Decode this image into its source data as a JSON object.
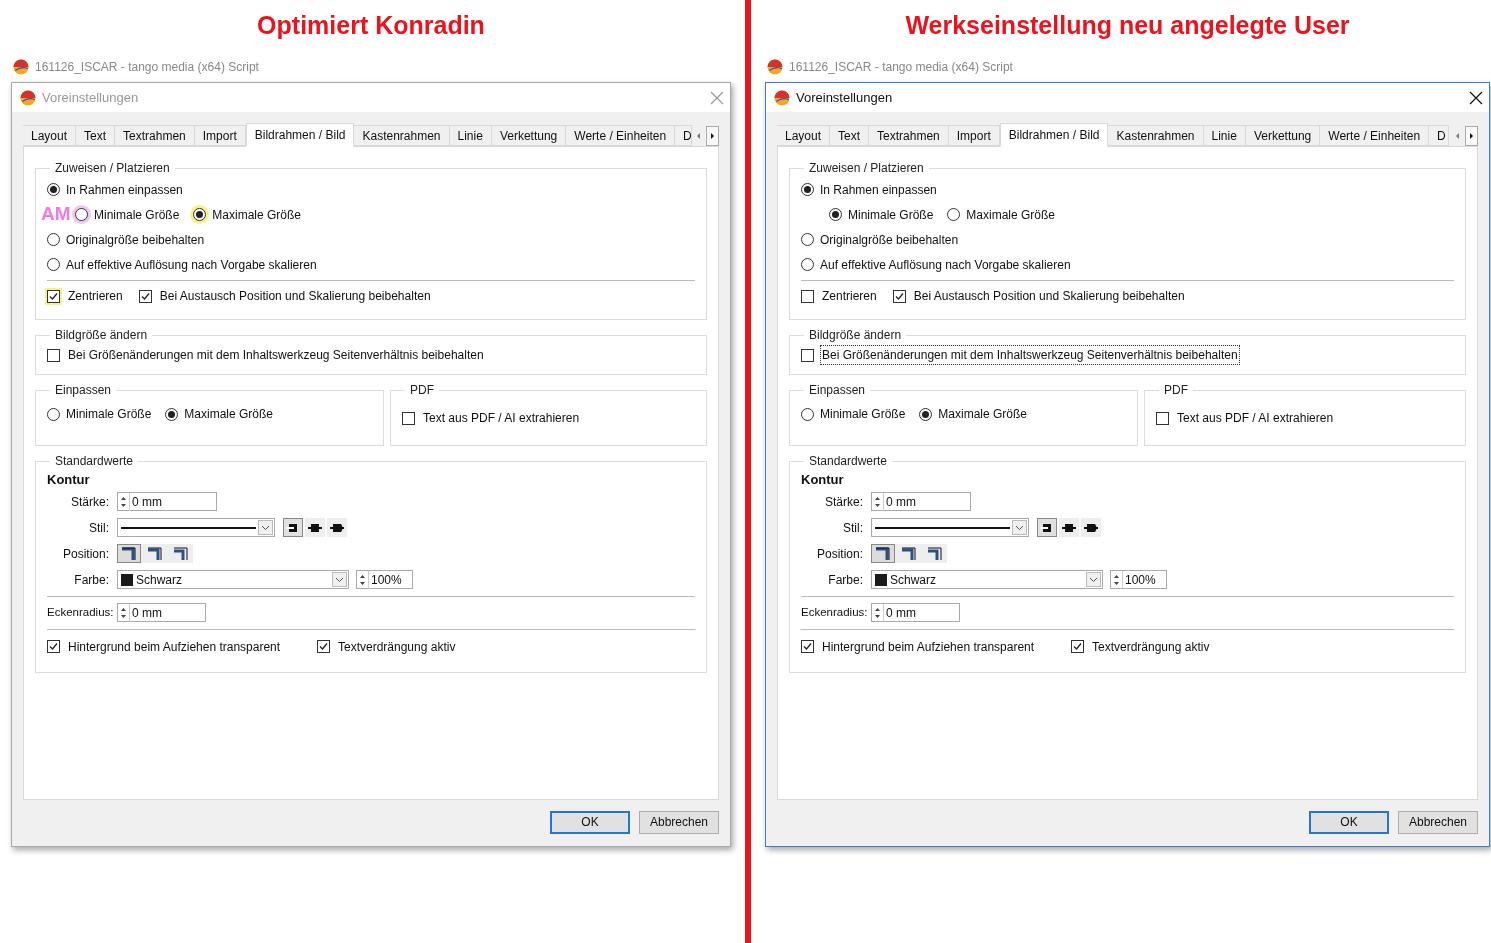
{
  "panels": [
    {
      "heading": "Optimiert Konradin",
      "app_title": "161126_ISCAR - tango media (x64) Script",
      "dialog": {
        "title": "Voreinstellungen",
        "active": false,
        "tabs": [
          {
            "label": "Layout",
            "selected": false
          },
          {
            "label": "Text",
            "selected": false
          },
          {
            "label": "Textrahmen",
            "selected": false
          },
          {
            "label": "Import",
            "selected": false
          },
          {
            "label": "Bildrahmen / Bild",
            "selected": true
          },
          {
            "label": "Kastenrahmen",
            "selected": false
          },
          {
            "label": "Linie",
            "selected": false
          },
          {
            "label": "Verkettung",
            "selected": false
          },
          {
            "label": "Werte / Einheiten",
            "selected": false
          },
          {
            "label": "D",
            "selected": false
          }
        ],
        "zuweisen": {
          "title": "Zuweisen / Platzieren",
          "annotation": {
            "text": "AM",
            "color": "#f07ae0"
          },
          "options": [
            {
              "label": "In Rahmen einpassen",
              "selected": true
            },
            {
              "label": "Originalgröße beibehalten",
              "selected": false
            },
            {
              "label": "Auf effektive Auflösung nach Vorgabe skalieren",
              "selected": false
            }
          ],
          "sub_options": [
            {
              "label": "Minimale Größe",
              "selected": false,
              "color": "#efc8ee"
            },
            {
              "label": "Maximale Größe",
              "selected": true,
              "color": "#f4f28a"
            }
          ],
          "checks": [
            {
              "label": "Zentrieren",
              "checked": true,
              "color": "#f4f28a"
            },
            {
              "label": "Bei Austausch Position und Skalierung beibehalten",
              "checked": true
            }
          ]
        },
        "bildgroesse": {
          "title": "Bildgröße ändern",
          "checks": [
            {
              "label": "Bei Größenänderungen mit dem Inhaltswerkzeug Seitenverhältnis beibehalten",
              "checked": false,
              "focused": false
            }
          ]
        },
        "einpassen": {
          "title": "Einpassen",
          "options": [
            {
              "label": "Minimale Größe",
              "selected": false
            },
            {
              "label": "Maximale Größe",
              "selected": true
            }
          ]
        },
        "pdf": {
          "title": "PDF",
          "checks": [
            {
              "label": "Text aus PDF / AI extrahieren",
              "checked": false
            }
          ]
        },
        "standard": {
          "title": "Standardwerte",
          "section": "Kontur",
          "staerke": {
            "label": "Stärke:",
            "value": "0 mm"
          },
          "stil": {
            "label": "Stil:",
            "caps": [
              {
                "selected": true
              },
              {
                "selected": false
              },
              {
                "selected": false
              }
            ]
          },
          "position": {
            "label": "Position:",
            "choices": [
              {
                "selected": true
              },
              {
                "selected": false
              },
              {
                "selected": false
              }
            ]
          },
          "farbe": {
            "label": "Farbe:",
            "value": "Schwarz",
            "color": "#1a1a1a",
            "percent": "100%"
          },
          "eckenradius": {
            "label": "Eckenradius:",
            "value": "0 mm"
          },
          "checks": [
            {
              "label": "Hintergrund beim Aufziehen transparent",
              "checked": true
            },
            {
              "label": "Textverdrängung aktiv",
              "checked": true
            }
          ]
        },
        "buttons": [
          {
            "label": "OK",
            "default": true
          },
          {
            "label": "Abbrechen",
            "default": false
          }
        ]
      }
    },
    {
      "heading": "Werkseinstellung neu angelegte User",
      "app_title": "161126_ISCAR - tango media (x64) Script",
      "dialog": {
        "title": "Voreinstellungen",
        "active": true,
        "tabs": [
          {
            "label": "Layout",
            "selected": false
          },
          {
            "label": "Text",
            "selected": false
          },
          {
            "label": "Textrahmen",
            "selected": false
          },
          {
            "label": "Import",
            "selected": false
          },
          {
            "label": "Bildrahmen / Bild",
            "selected": true
          },
          {
            "label": "Kastenrahmen",
            "selected": false
          },
          {
            "label": "Linie",
            "selected": false
          },
          {
            "label": "Verkettung",
            "selected": false
          },
          {
            "label": "Werte / Einheiten",
            "selected": false
          },
          {
            "label": "D",
            "selected": false
          }
        ],
        "zuweisen": {
          "title": "Zuweisen / Platzieren",
          "options": [
            {
              "label": "In Rahmen einpassen",
              "selected": true
            },
            {
              "label": "Originalgröße beibehalten",
              "selected": false
            },
            {
              "label": "Auf effektive Auflösung nach Vorgabe skalieren",
              "selected": false
            }
          ],
          "sub_options": [
            {
              "label": "Minimale Größe",
              "selected": true
            },
            {
              "label": "Maximale Größe",
              "selected": false
            }
          ],
          "checks": [
            {
              "label": "Zentrieren",
              "checked": false
            },
            {
              "label": "Bei Austausch Position und Skalierung beibehalten",
              "checked": true
            }
          ]
        },
        "bildgroesse": {
          "title": "Bildgröße ändern",
          "checks": [
            {
              "label": "Bei Größenänderungen mit dem Inhaltswerkzeug Seitenverhältnis beibehalten",
              "checked": false,
              "focused": true
            }
          ]
        },
        "einpassen": {
          "title": "Einpassen",
          "options": [
            {
              "label": "Minimale Größe",
              "selected": false
            },
            {
              "label": "Maximale Größe",
              "selected": true
            }
          ]
        },
        "pdf": {
          "title": "PDF",
          "checks": [
            {
              "label": "Text aus PDF / AI extrahieren",
              "checked": false
            }
          ]
        },
        "standard": {
          "title": "Standardwerte",
          "section": "Kontur",
          "staerke": {
            "label": "Stärke:",
            "value": "0 mm"
          },
          "stil": {
            "label": "Stil:",
            "caps": [
              {
                "selected": true
              },
              {
                "selected": false
              },
              {
                "selected": false
              }
            ]
          },
          "position": {
            "label": "Position:",
            "choices": [
              {
                "selected": true
              },
              {
                "selected": false
              },
              {
                "selected": false
              }
            ]
          },
          "farbe": {
            "label": "Farbe:",
            "value": "Schwarz",
            "color": "#1a1a1a",
            "percent": "100%"
          },
          "eckenradius": {
            "label": "Eckenradius:",
            "value": "0 mm"
          },
          "checks": [
            {
              "label": "Hintergrund beim Aufziehen transparent",
              "checked": true
            },
            {
              "label": "Textverdrängung aktiv",
              "checked": true
            }
          ]
        },
        "buttons": [
          {
            "label": "OK",
            "default": true
          },
          {
            "label": "Abbrechen",
            "default": false
          }
        ]
      }
    }
  ]
}
